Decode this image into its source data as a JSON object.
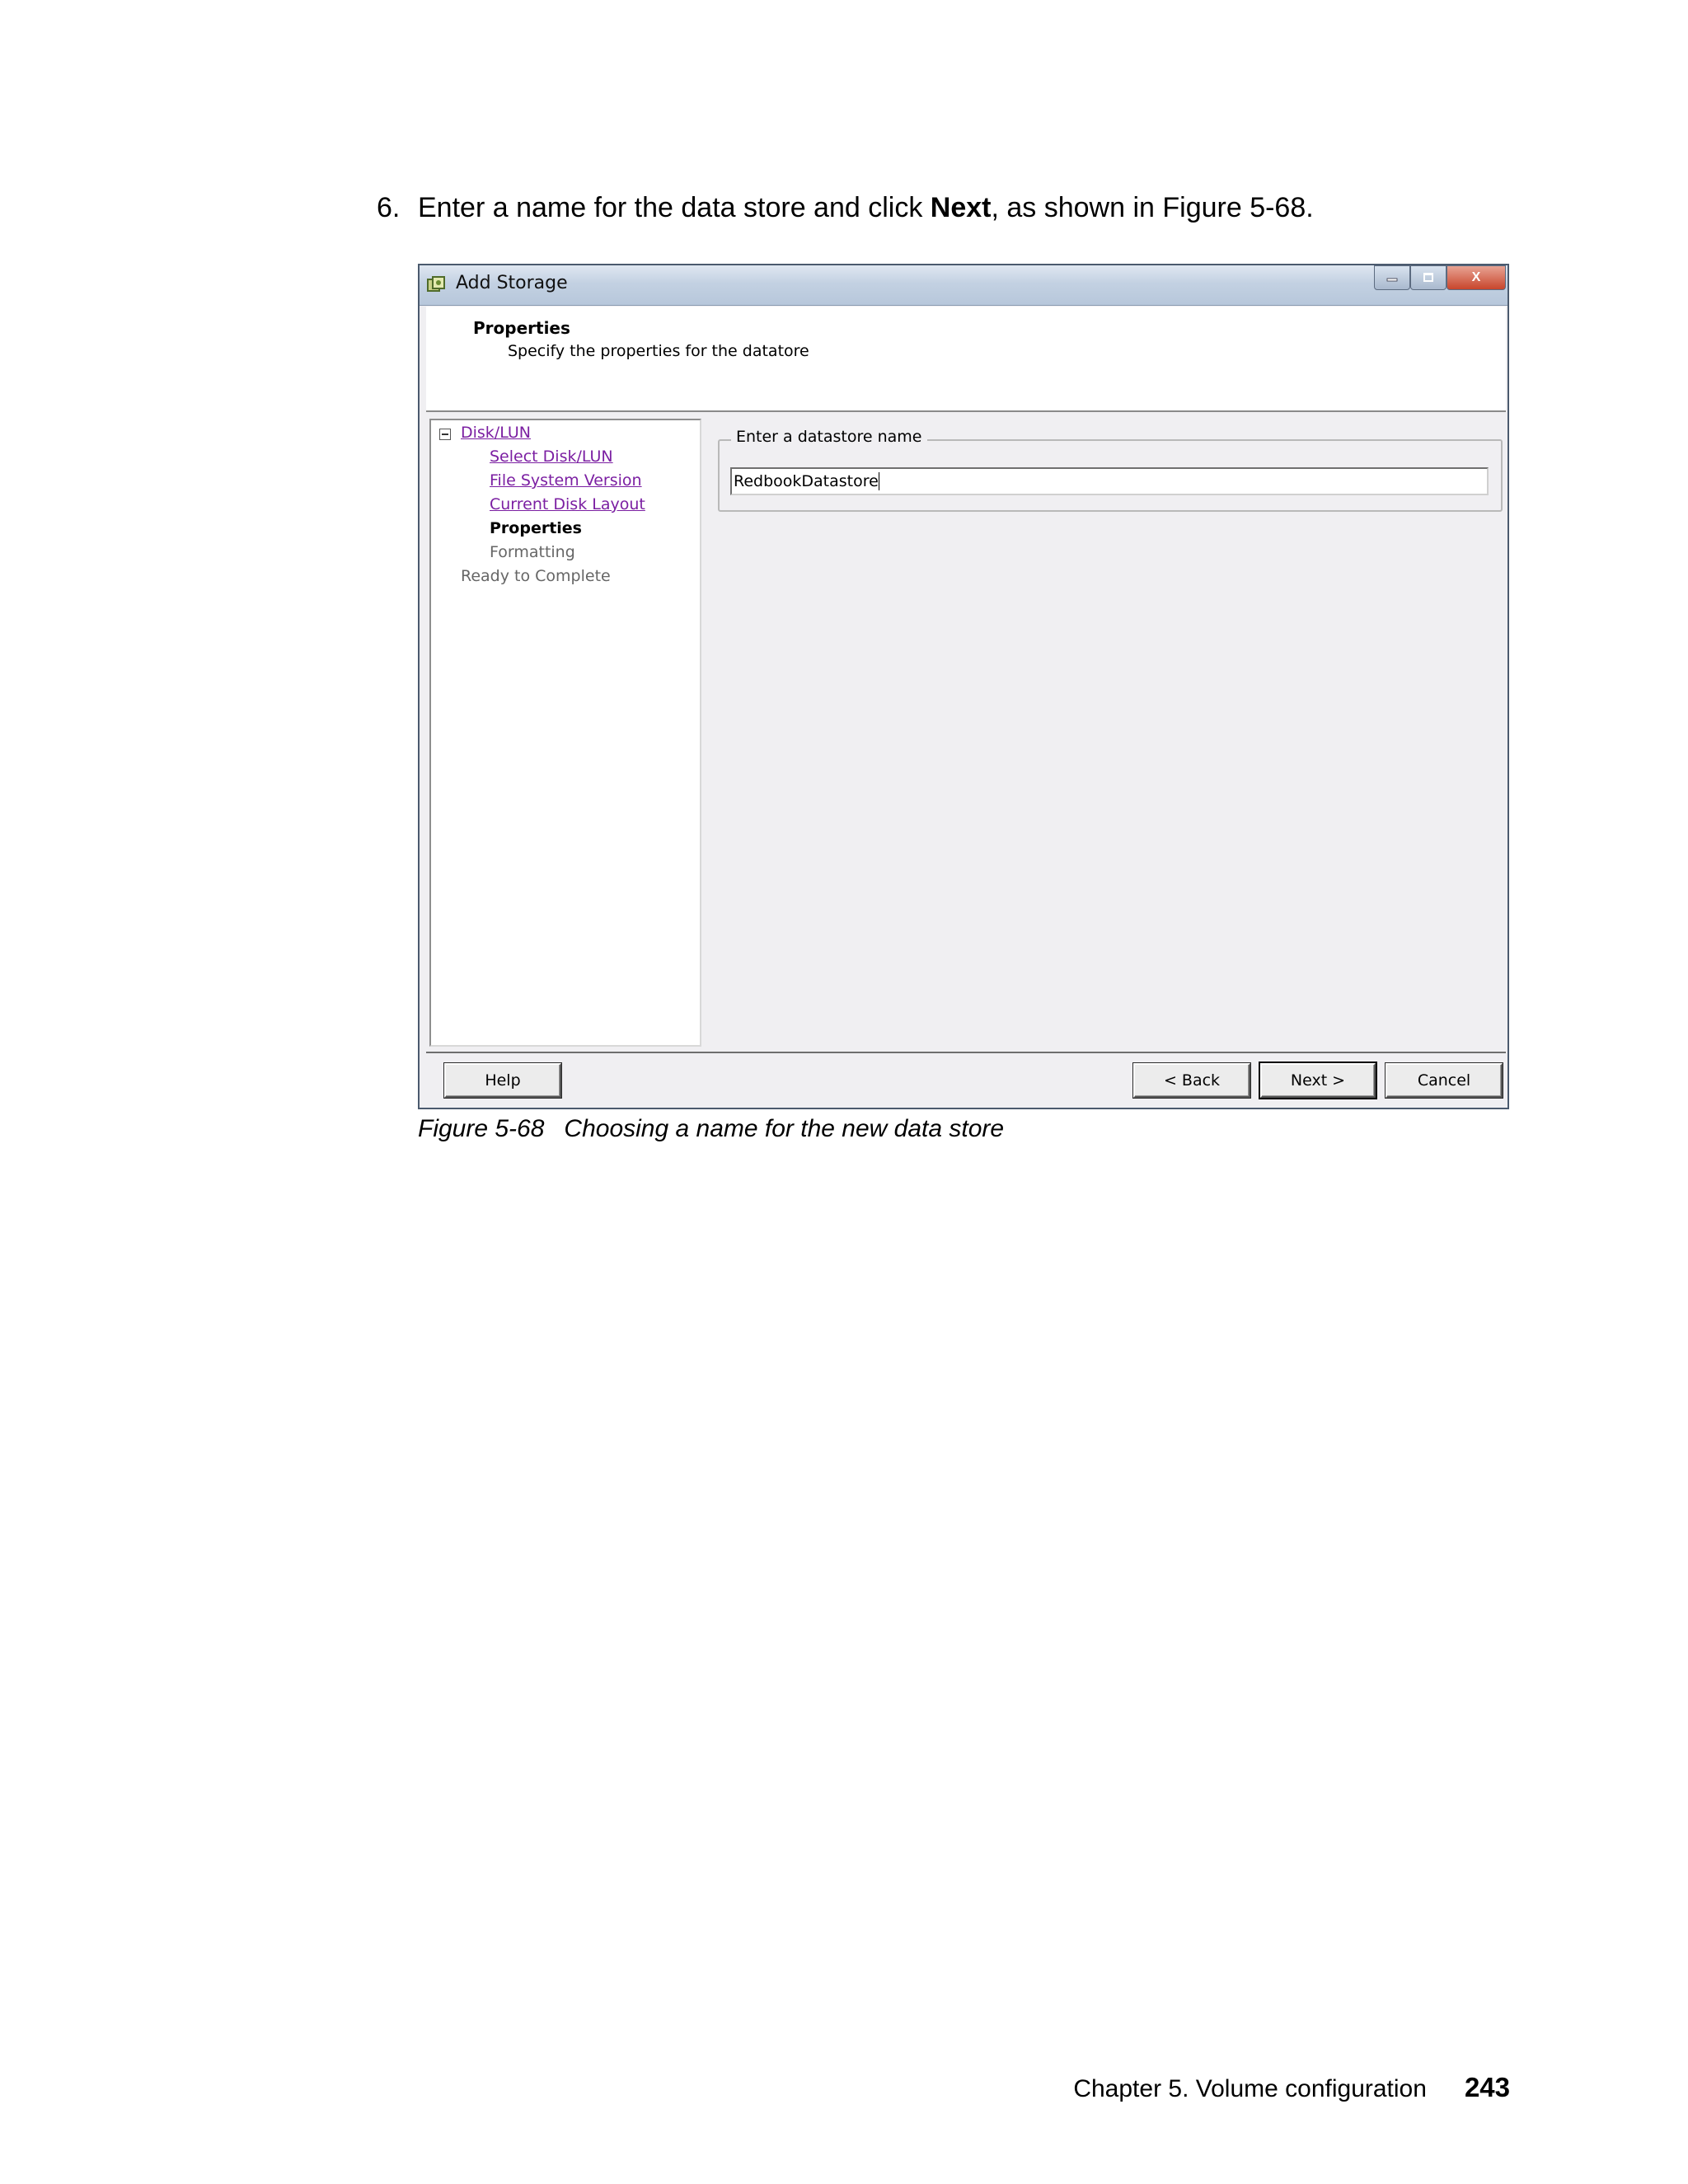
{
  "instruction": {
    "number": "6.",
    "before": "Enter a name for the data store and click ",
    "bold": "Next",
    "after": ", as shown in Figure 5-68."
  },
  "dialog": {
    "title": "Add Storage",
    "header_title": "Properties",
    "header_subtitle": "Specify the properties for the datatore",
    "nav": {
      "root": "Disk/LUN",
      "items": [
        "Select Disk/LUN",
        "File System Version",
        "Current Disk Layout",
        "Properties",
        "Formatting"
      ],
      "final": "Ready to Complete"
    },
    "name_group_label": "Enter a datastore name",
    "name_value": "RedbookDatastore",
    "buttons": {
      "help": "Help",
      "back": "< Back",
      "next": "Next >",
      "cancel": "Cancel"
    },
    "window_controls": {
      "minimize_icon": "minimize-icon",
      "maximize_icon": "maximize-icon",
      "close_icon": "close-icon",
      "close_glyph": "X"
    }
  },
  "caption": {
    "number": "Figure 5-68",
    "text": "Choosing a name for the new data store"
  },
  "page_footer": {
    "chapter": "Chapter 5. Volume configuration",
    "page": "243"
  }
}
